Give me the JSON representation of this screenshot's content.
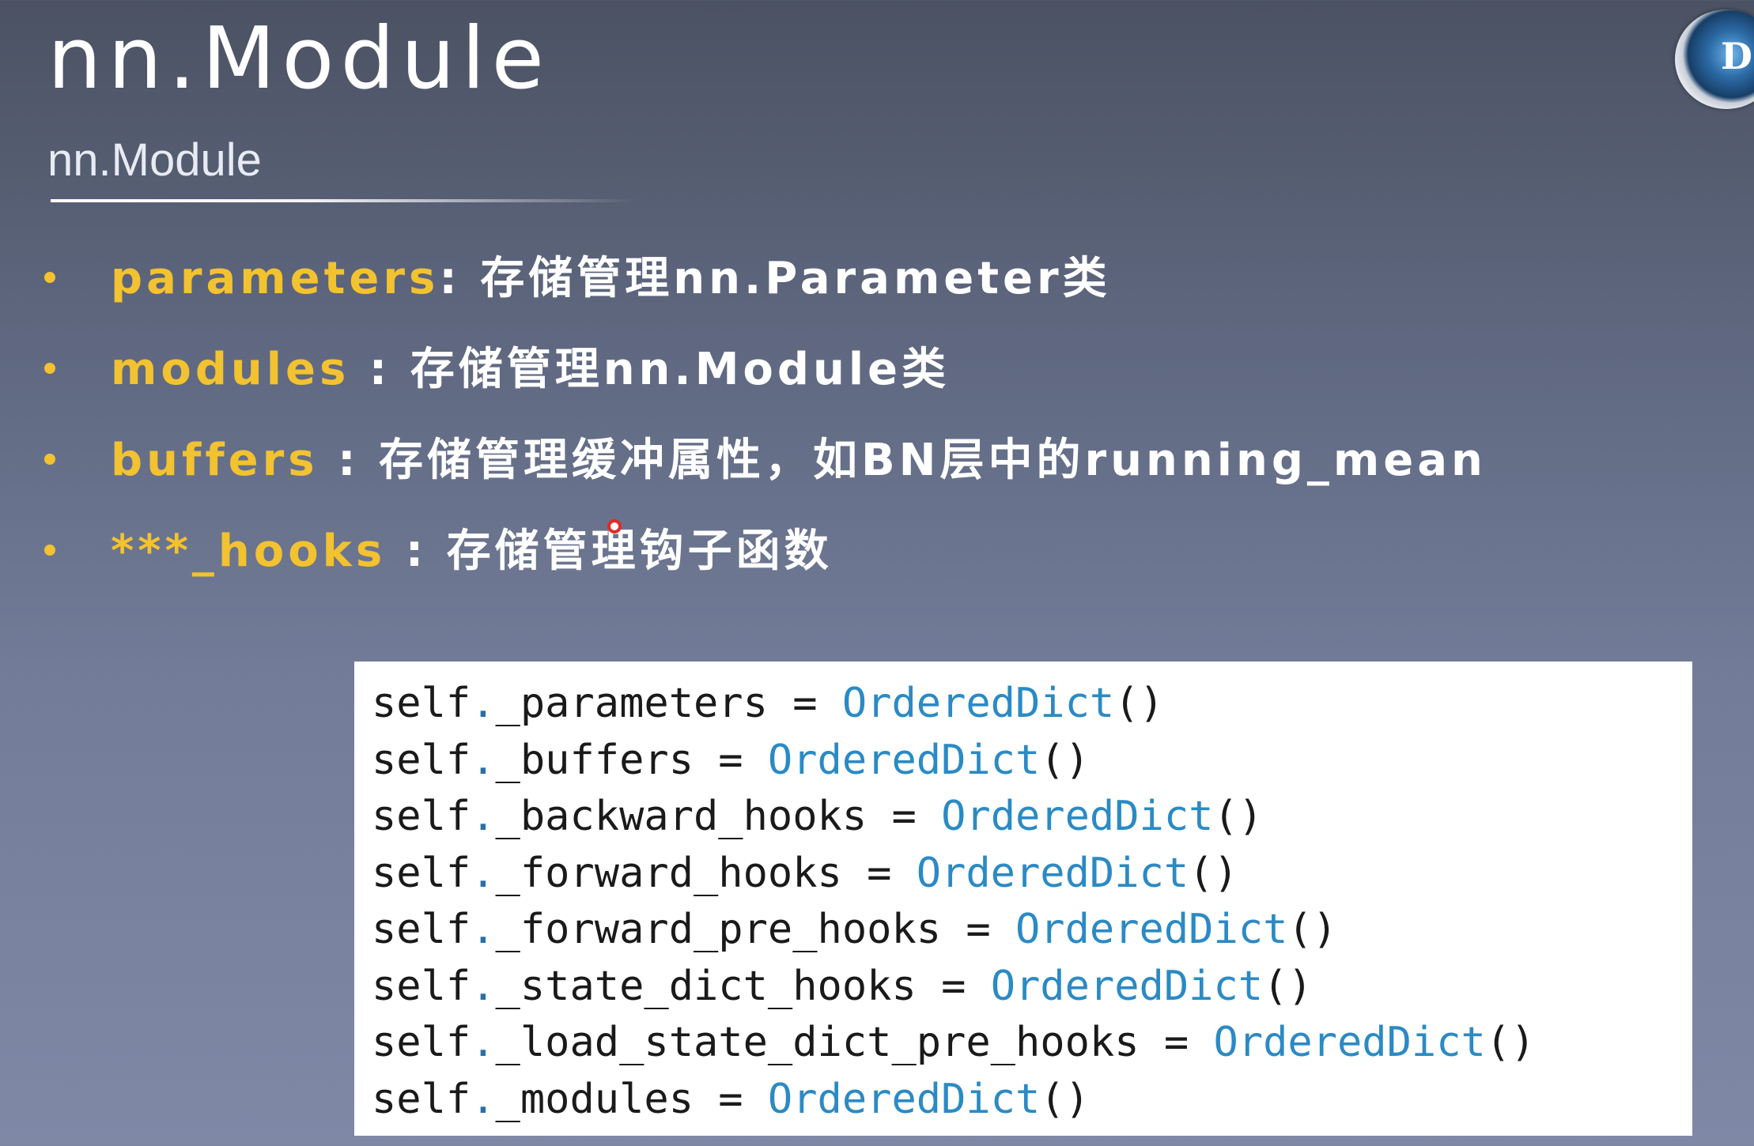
{
  "slide": {
    "title": "nn.Module",
    "subtitle": "nn.Module",
    "logo_letter": "D",
    "bullets": [
      {
        "keyword": "parameters",
        "separator": ": ",
        "description": "存储管理nn.Parameter类"
      },
      {
        "keyword": "modules",
        "separator": " : ",
        "description": "存储管理nn.Module类"
      },
      {
        "keyword": "buffers",
        "separator": " : ",
        "description": "存储管理缓冲属性，如BN层中的running_mean"
      },
      {
        "keyword": "***_hooks",
        "separator": " : ",
        "description": "存储管理钩子函数"
      }
    ],
    "code_lines": [
      {
        "obj": "self",
        "dot": ".",
        "attr": "_parameters = ",
        "cls": "OrderedDict",
        "call": "()"
      },
      {
        "obj": "self",
        "dot": ".",
        "attr": "_buffers = ",
        "cls": "OrderedDict",
        "call": "()"
      },
      {
        "obj": "self",
        "dot": ".",
        "attr": "_backward_hooks = ",
        "cls": "OrderedDict",
        "call": "()"
      },
      {
        "obj": "self",
        "dot": ".",
        "attr": "_forward_hooks = ",
        "cls": "OrderedDict",
        "call": "()"
      },
      {
        "obj": "self",
        "dot": ".",
        "attr": "_forward_pre_hooks = ",
        "cls": "OrderedDict",
        "call": "()"
      },
      {
        "obj": "self",
        "dot": ".",
        "attr": "_state_dict_hooks = ",
        "cls": "OrderedDict",
        "call": "()"
      },
      {
        "obj": "self",
        "dot": ".",
        "attr": "_load_state_dict_pre_hooks = ",
        "cls": "OrderedDict",
        "call": "()"
      },
      {
        "obj": "self",
        "dot": ".",
        "attr": "_modules = ",
        "cls": "OrderedDict",
        "call": "()"
      }
    ]
  },
  "colors": {
    "keyword": "#f2c230",
    "description": "#ffffff",
    "code_class": "#2b8ac4",
    "code_text": "#1a1a1a"
  },
  "icons": {
    "logo": "dtech-logo-icon",
    "cursor": "mouse-cursor-icon"
  }
}
